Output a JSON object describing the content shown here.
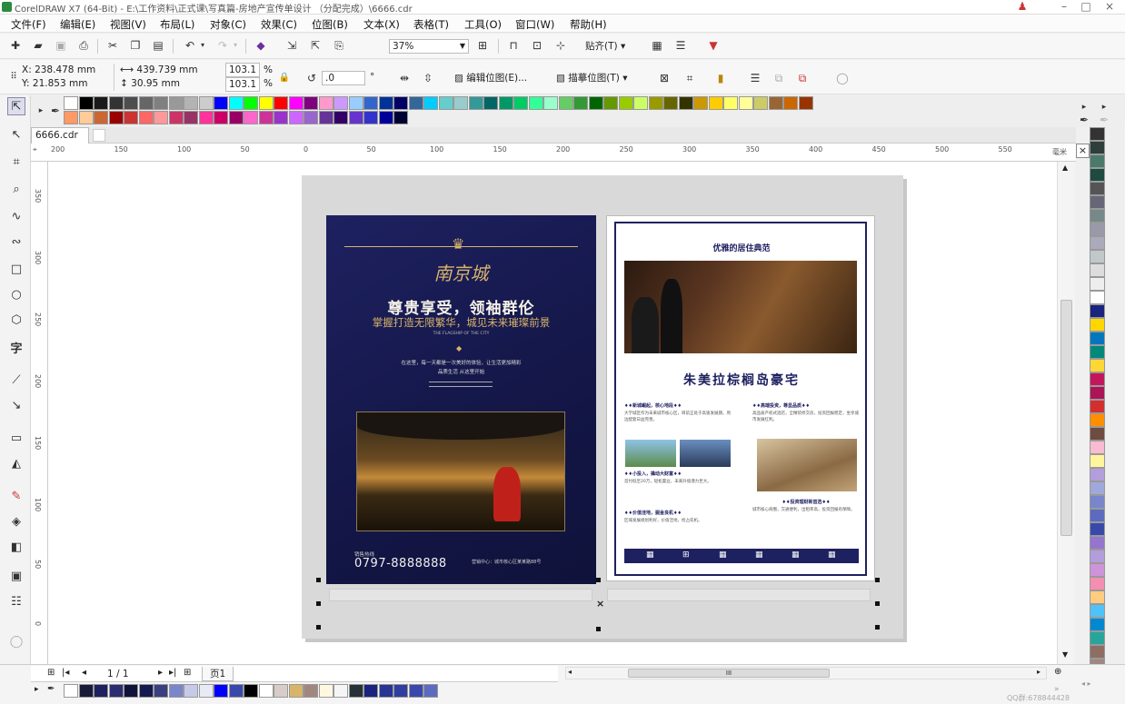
{
  "window": {
    "title": "CorelDRAW X7 (64-Bit) - E:\\工作资料\\正式课\\写真篇-房地产宣传单设计 （分配完成）\\6666.cdr"
  },
  "menu": [
    "文件(F)",
    "编辑(E)",
    "视图(V)",
    "布局(L)",
    "对象(C)",
    "效果(C)",
    "位图(B)",
    "文本(X)",
    "表格(T)",
    "工具(O)",
    "窗口(W)",
    "帮助(H)"
  ],
  "toolbar": {
    "zoom": "37%",
    "snap_label": "贴齐(T)"
  },
  "propbar": {
    "x": "X: 238.478 mm",
    "y": "Y: 21.853 mm",
    "w": "439.739 mm",
    "h": "30.95 mm",
    "sx": "103.1",
    "sy": "103.1",
    "pct": "%",
    "angle": ".0",
    "deg": "°",
    "edit_bitmap": "编辑位图(E)...",
    "trace_bitmap": "描摹位图(T)"
  },
  "doc_tab": "6666.cdr",
  "ruler_unit": "毫米",
  "ruler_h": [
    "200",
    "150",
    "100",
    "50",
    "0",
    "50",
    "100",
    "150",
    "200",
    "250",
    "300",
    "350",
    "400",
    "450",
    "500",
    "550"
  ],
  "ruler_v": [
    "350",
    "300",
    "250",
    "200",
    "150",
    "100",
    "50",
    "0"
  ],
  "poster_left": {
    "brand": "南京城",
    "headline": "尊贵享受，领袖群伦",
    "subline": "掌握打造无限繁华，城见未来璀璨前景",
    "tiny_en": "THE FLAGSHIP OF THE CITY",
    "body1": "在这里，每一天都是一次美好的体验，让生活更加精彩",
    "body2": "品质生活 从这里开始",
    "hotline_label": "销售热线",
    "phone": "0797-8888888",
    "address": "营销中心：城市核心区某某路88号"
  },
  "poster_right": {
    "top_title": "优雅的居住典范",
    "main_title": "朱美拉棕榈岛豪宅",
    "s1_title": "♦♦新城崛起，核心地段♦♦",
    "s1_text": "大学城区作为未来城市核心区，目前正处于高速发展期，周边配套日益完善。",
    "s2_title": "♦♦高端投资，尊显品质♦♦",
    "s2_text": "高品质产权式酒店，全精装修交房，投资回报稳定，坐享城市发展红利。",
    "s3_title": "♦♦小投入，撬动大财富♦♦",
    "s3_text": "首付低至20万，轻松置业，未来升值潜力巨大。",
    "s4_title": "♦♦投资理财新首选♦♦",
    "s4_text": "城市核心商圈，交通便利，出租率高，投资回报有保障。",
    "s5_title": "♦♦价值洼地，掘金良机♦♦",
    "s5_text": "区域发展规划利好，价值洼地，抢占先机。"
  },
  "page_nav": {
    "count": "1 / 1",
    "page_tab": "页1"
  },
  "hscroll_label": "III",
  "watermark": "QQ群:678844428",
  "colors": {
    "accent": "#1e2160",
    "gold": "#d8b46a",
    "canvas": "#ffffff"
  }
}
